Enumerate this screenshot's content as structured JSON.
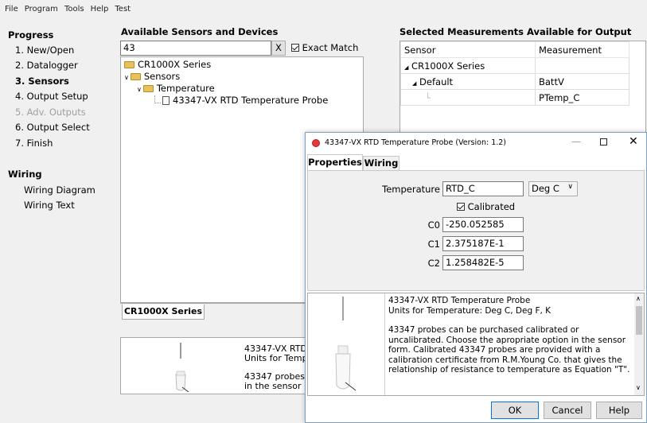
{
  "menu": [
    "File",
    "Program",
    "Tools",
    "Help",
    "Test"
  ],
  "nav": {
    "progress_heading": "Progress",
    "progress_items": [
      {
        "label": "1. New/Open",
        "state": "normal"
      },
      {
        "label": "2. Datalogger",
        "state": "normal"
      },
      {
        "label": "3. Sensors",
        "state": "active"
      },
      {
        "label": "4. Output Setup",
        "state": "normal"
      },
      {
        "label": "5. Adv. Outputs",
        "state": "disabled"
      },
      {
        "label": "6. Output Select",
        "state": "normal"
      },
      {
        "label": "7. Finish",
        "state": "normal"
      }
    ],
    "wiring_heading": "Wiring",
    "wiring_items": [
      "Wiring Diagram",
      "Wiring Text"
    ]
  },
  "sensors": {
    "heading": "Available Sensors and Devices",
    "search_value": "43",
    "clear_label": "X",
    "exact_match_label": "Exact Match",
    "tree": [
      "CR1000X Series",
      "Sensors",
      "Temperature",
      "43347-VX RTD Temperature Probe"
    ],
    "tab_label": "CR1000X Series",
    "desc_title": "43347-VX RTD",
    "desc_units": "Units for Temp",
    "desc_text1": "43347 probes",
    "desc_text2": "in the sensor"
  },
  "measurements": {
    "heading": "Selected Measurements Available for Output",
    "col_sensor": "Sensor",
    "col_measurement": "Measurement",
    "rows": [
      {
        "sensor": "CR1000X Series",
        "measurement": ""
      },
      {
        "sensor": "Default",
        "measurement": "BattV"
      },
      {
        "sensor": "",
        "measurement": "PTemp_C"
      }
    ]
  },
  "dialog": {
    "title": "43347-VX RTD Temperature Probe (Version: 1.2)",
    "tab_properties": "Properties",
    "tab_wiring": "Wiring",
    "temperature_label": "Temperature",
    "temperature_value": "RTD_C",
    "unit_value": "Deg C",
    "calibrated_label": "Calibrated",
    "c0_label": "C0",
    "c0_value": "-250.052585",
    "c1_label": "C1",
    "c1_value": "2.375187E-1",
    "c2_label": "C2",
    "c2_value": "1.258482E-5",
    "desc_title": "43347-VX RTD Temperature Probe",
    "desc_units": "Units for Temperature: Deg C, Deg F, K",
    "desc_body": "43347 probes can be purchased calibrated or uncalibrated. Choose the apropriate option in the sensor form. Calibrated 43347 probes are provided with a calibration certificate from R.M.Young Co. that gives the relationship of resistance to temperature as Equation \"T\".",
    "ok_label": "OK",
    "cancel_label": "Cancel",
    "help_label": "Help"
  }
}
